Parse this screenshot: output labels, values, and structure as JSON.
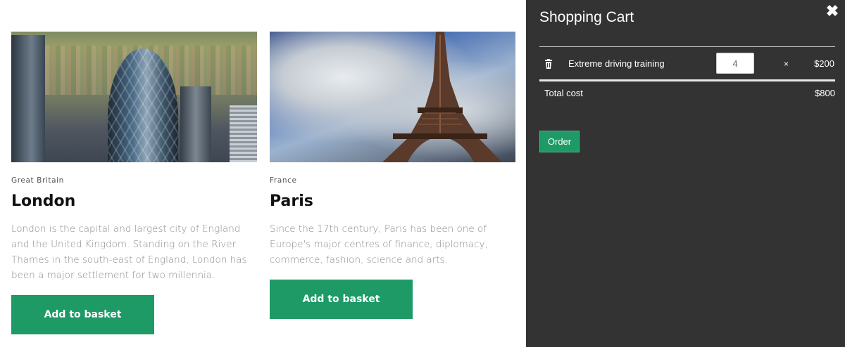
{
  "products": [
    {
      "country": "Great Britain",
      "city": "London",
      "description": "London is the capital and largest city of England and the United Kingdom. Standing on the River Thames in the south-east of England, London has been a major settlement for two millennia.",
      "button_label": "Add to basket"
    },
    {
      "country": "France",
      "city": "Paris",
      "description": "Since the 17th century, Paris has been one of Europe's major centres of finance, diplomacy, commerce, fashion, science and arts.",
      "button_label": "Add to basket"
    }
  ],
  "cart": {
    "title": "Shopping Cart",
    "close_icon": "close-icon",
    "items": [
      {
        "name": "Extreme driving training",
        "quantity": "4",
        "times_symbol": "×",
        "price": "$200",
        "delete_icon": "trash-icon"
      }
    ],
    "total_label": "Total cost",
    "total_value": "$800",
    "order_label": "Order"
  },
  "colors": {
    "accent_green": "#1d9a66",
    "cart_background": "#333333"
  }
}
